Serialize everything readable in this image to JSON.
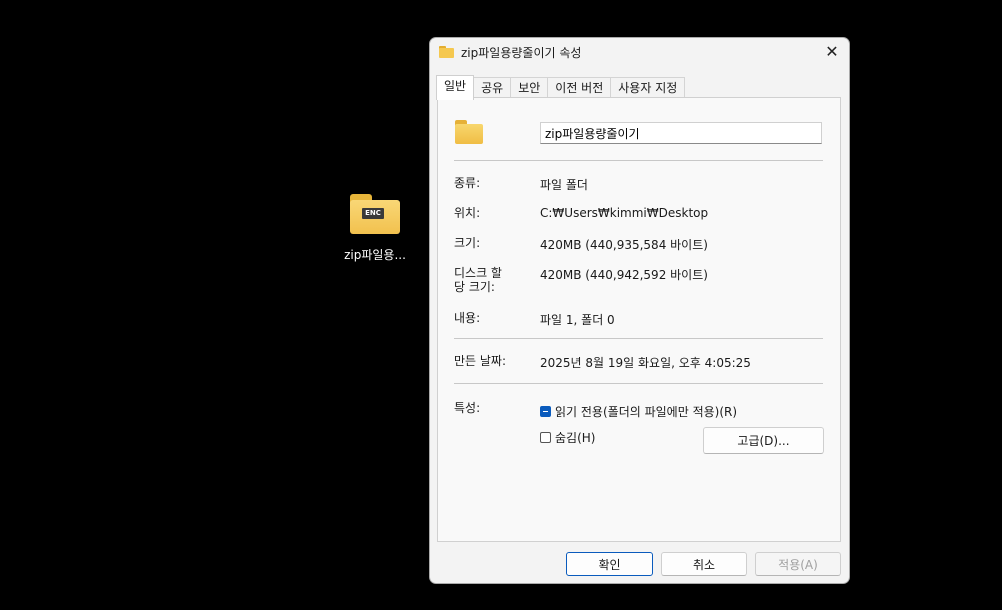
{
  "desktop": {
    "icon_label": "zip파일용...",
    "icon_badge": "ENC"
  },
  "dialog": {
    "title": "zip파일용량줄이기 속성",
    "close": "✕",
    "tabs": [
      "일반",
      "공유",
      "보안",
      "이전 버전",
      "사용자 지정"
    ],
    "name_value": "zip파일용량줄이기",
    "fields": {
      "type_label": "종류:",
      "type_value": "파일 폴더",
      "location_label": "위치:",
      "location_value": "C:₩Users₩kimmi₩Desktop",
      "size_label": "크기:",
      "size_value": "420MB (440,935,584 바이트)",
      "disk_size_label_1": "디스크 할",
      "disk_size_label_2": "당 크기:",
      "disk_size_value": "420MB (440,942,592 바이트)",
      "contents_label": "내용:",
      "contents_value": "파일 1, 폴더 0",
      "created_label": "만든 날짜:",
      "created_value": "2025년 8월 19일 화요일, 오후 4:05:25",
      "attributes_label": "특성:"
    },
    "attributes": {
      "readonly_label": "읽기 전용(폴더의 파일에만 적용)(R)",
      "hidden_label": "숨김(H)",
      "advanced_button": "고급(D)..."
    },
    "buttons": {
      "ok": "확인",
      "cancel": "취소",
      "apply": "적용(A)"
    }
  }
}
